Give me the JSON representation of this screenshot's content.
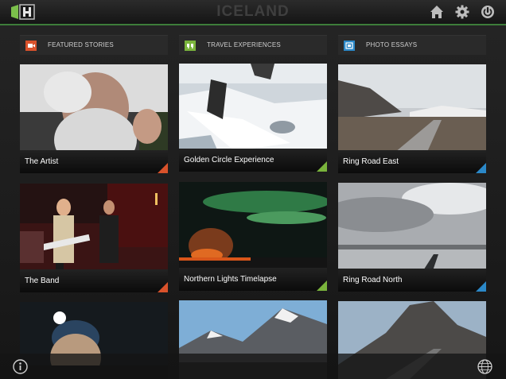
{
  "app": {
    "title": "ICELAND"
  },
  "header": {
    "icons": [
      "logo-icon",
      "home-icon",
      "gear-icon",
      "power-icon"
    ]
  },
  "categories": [
    {
      "label": "FEATURED STORIES",
      "icon": "video-icon",
      "color": "#d9522b"
    },
    {
      "label": "TRAVEL EXPERIENCES",
      "icon": "quote-icon",
      "color": "#7ab43c"
    },
    {
      "label": "PHOTO ESSAYS",
      "icon": "photo-icon",
      "color": "#2b88c8"
    }
  ],
  "tiles": {
    "col1": [
      {
        "caption": "The Artist"
      },
      {
        "caption": "The Band"
      },
      {
        "caption": ""
      }
    ],
    "col2": [
      {
        "caption": "Golden Circle Experience"
      },
      {
        "caption": "Northern Lights Timelapse"
      },
      {
        "caption": ""
      }
    ],
    "col3": [
      {
        "caption": "Ring Road East"
      },
      {
        "caption": "Ring Road North"
      },
      {
        "caption": ""
      }
    ]
  },
  "footer": {
    "icons": [
      "info-icon",
      "globe-icon"
    ]
  }
}
